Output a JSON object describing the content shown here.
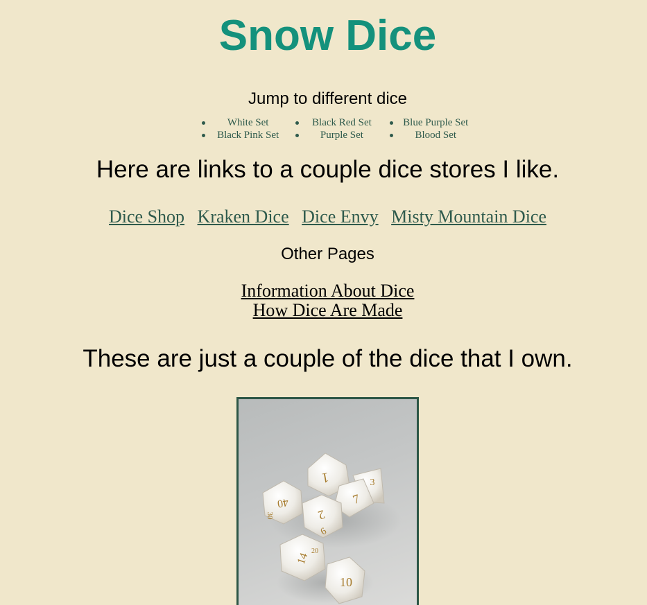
{
  "page": {
    "title": "Snow Dice"
  },
  "jump": {
    "heading": "Jump to different dice",
    "items": [
      {
        "label": "White Set"
      },
      {
        "label": "Black Red Set"
      },
      {
        "label": "Blue Purple Set"
      },
      {
        "label": "Black Pink Set"
      },
      {
        "label": "Purple Set"
      },
      {
        "label": "Blood Set"
      }
    ]
  },
  "stores": {
    "heading": "Here are links to a couple dice stores I like.",
    "links": [
      {
        "label": "Dice Shop"
      },
      {
        "label": "Kraken Dice"
      },
      {
        "label": "Dice Envy"
      },
      {
        "label": "Misty Mountain Dice"
      }
    ]
  },
  "other_pages": {
    "heading": "Other Pages",
    "links": [
      {
        "label": "Information About Dice"
      },
      {
        "label": "How Dice Are Made"
      }
    ]
  },
  "gallery": {
    "heading": "These are just a couple of the dice that I own.",
    "photo": {
      "subject": "white-marbled-dice-set-photo"
    }
  },
  "colors": {
    "background": "#f0e7cb",
    "title": "#14917c",
    "link": "#2e5a4c",
    "frame": "#2c5646"
  }
}
